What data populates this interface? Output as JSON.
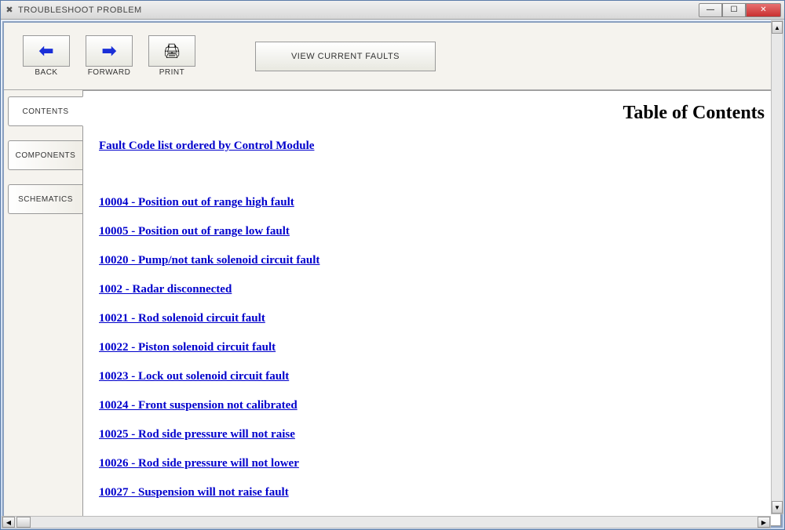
{
  "window": {
    "title": "TROUBLESHOOT PROBLEM"
  },
  "toolbar": {
    "back_label": "BACK",
    "forward_label": "FORWARD",
    "print_label": "PRINT",
    "view_faults_label": "VIEW CURRENT FAULTS"
  },
  "tabs": {
    "contents": "CONTENTS",
    "components": "COMPONENTS",
    "schematics": "SCHEMATICS"
  },
  "content": {
    "title": "Table of Contents",
    "header_link": "Fault Code list ordered by Control Module",
    "links": [
      "10004 - Position out of range high fault",
      "10005 - Position out of range low fault",
      "10020 - Pump/not tank solenoid circuit fault",
      "1002 - Radar disconnected",
      "10021 - Rod solenoid circuit fault",
      "10022 - Piston solenoid circuit fault",
      "10023 - Lock out solenoid circuit fault",
      "10024 - Front suspension not calibrated",
      "10025 - Rod side pressure will not raise",
      "10026 - Rod side pressure will not lower",
      "10027 - Suspension will not raise fault"
    ]
  }
}
